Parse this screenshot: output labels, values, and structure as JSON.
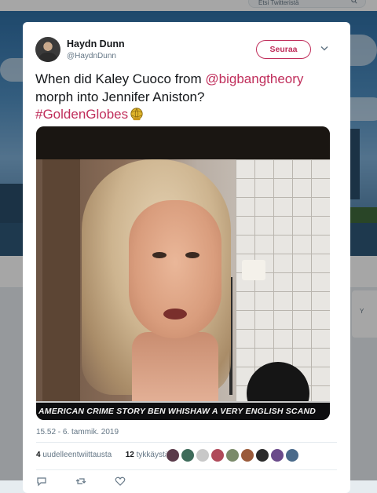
{
  "background": {
    "search_placeholder": "Etsi Twitteristä",
    "right_card_text": "Y"
  },
  "tweet": {
    "author_name": "Haydn Dunn",
    "author_handle": "@HaydnDunn",
    "follow_label": "Seuraa",
    "text_before": "When did Kaley Cuoco from ",
    "mention": "@bigbangtheory",
    "text_after": " morph into Jennifer Aniston?",
    "hashtag": "#GoldenGlobes",
    "photo_ticker": "AMERICAN CRIME STORY   BEN WHISHAW  A VERY ENGLISH SCAND",
    "timestamp": "15.52 - 6. tammik. 2019",
    "retweets_count": "4",
    "retweets_label": "uudelleentwiittausta",
    "likes_count": "12",
    "likes_label": "tykkäystä"
  },
  "icons": {
    "avatar": "avatar-icon",
    "chevron": "chevron-down-icon",
    "globe": "golden-globe-emoji-icon",
    "reply": "reply-icon",
    "retweet": "retweet-icon",
    "like": "heart-icon"
  },
  "colors": {
    "accent": "#c02e5b",
    "text": "#14171a",
    "secondary": "#657786"
  }
}
